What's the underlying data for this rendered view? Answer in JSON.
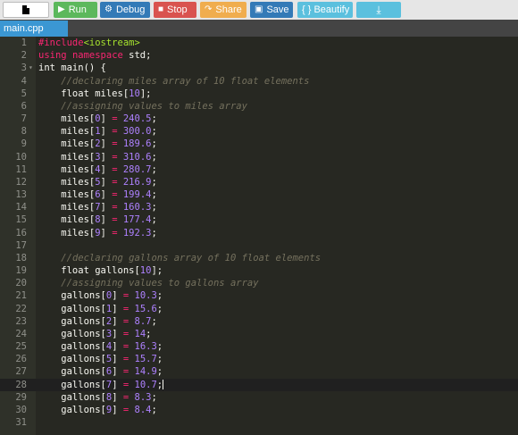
{
  "toolbar": {
    "new_label": "",
    "run_label": "Run",
    "debug_label": "Debug",
    "stop_label": "Stop",
    "share_label": "Share",
    "save_label": "Save",
    "beautify_label": "{ } Beautify",
    "download_label": ""
  },
  "tabs": [
    {
      "label": "main.cpp"
    }
  ],
  "editor": {
    "active_line": 28,
    "lines": [
      {
        "n": "1",
        "fold": "",
        "text": "#include<iostream>"
      },
      {
        "n": "2",
        "fold": "",
        "text": "using namespace std;"
      },
      {
        "n": "3",
        "fold": "▾",
        "text": "int main() {"
      },
      {
        "n": "4",
        "fold": "",
        "text": "    //declaring miles array of 10 float elements"
      },
      {
        "n": "5",
        "fold": "",
        "text": "    float miles[10];"
      },
      {
        "n": "6",
        "fold": "",
        "text": "    //assigning values to miles array"
      },
      {
        "n": "7",
        "fold": "",
        "text": "    miles[0] = 240.5;"
      },
      {
        "n": "8",
        "fold": "",
        "text": "    miles[1] = 300.0;"
      },
      {
        "n": "9",
        "fold": "",
        "text": "    miles[2] = 189.6;"
      },
      {
        "n": "10",
        "fold": "",
        "text": "    miles[3] = 310.6;"
      },
      {
        "n": "11",
        "fold": "",
        "text": "    miles[4] = 280.7;"
      },
      {
        "n": "12",
        "fold": "",
        "text": "    miles[5] = 216.9;"
      },
      {
        "n": "13",
        "fold": "",
        "text": "    miles[6] = 199.4;"
      },
      {
        "n": "14",
        "fold": "",
        "text": "    miles[7] = 160.3;"
      },
      {
        "n": "15",
        "fold": "",
        "text": "    miles[8] = 177.4;"
      },
      {
        "n": "16",
        "fold": "",
        "text": "    miles[9] = 192.3;"
      },
      {
        "n": "17",
        "fold": "",
        "text": ""
      },
      {
        "n": "18",
        "fold": "",
        "text": "    //declaring gallons array of 10 float elements"
      },
      {
        "n": "19",
        "fold": "",
        "text": "    float gallons[10];"
      },
      {
        "n": "20",
        "fold": "",
        "text": "    //assigning values to gallons array"
      },
      {
        "n": "21",
        "fold": "",
        "text": "    gallons[0] = 10.3;"
      },
      {
        "n": "22",
        "fold": "",
        "text": "    gallons[1] = 15.6;"
      },
      {
        "n": "23",
        "fold": "",
        "text": "    gallons[2] = 8.7;"
      },
      {
        "n": "24",
        "fold": "",
        "text": "    gallons[3] = 14;"
      },
      {
        "n": "25",
        "fold": "",
        "text": "    gallons[4] = 16.3;"
      },
      {
        "n": "26",
        "fold": "",
        "text": "    gallons[5] = 15.7;"
      },
      {
        "n": "27",
        "fold": "",
        "text": "    gallons[6] = 14.9;"
      },
      {
        "n": "28",
        "fold": "",
        "text": "    gallons[7] = 10.7;"
      },
      {
        "n": "29",
        "fold": "",
        "text": "    gallons[8] = 8.3;"
      },
      {
        "n": "30",
        "fold": "",
        "text": "    gallons[9] = 8.4;"
      },
      {
        "n": "31",
        "fold": "",
        "text": ""
      }
    ]
  },
  "colors": {
    "editor_bg": "#272822",
    "gutter_bg": "#2f3129",
    "tab_active": "#3b97d3",
    "run": "#5cb85c",
    "debug": "#337ab7",
    "stop": "#d9534f",
    "share": "#f0ad4e",
    "beautify": "#5bc0de"
  },
  "icons": {
    "new": "file-icon",
    "run": "play-icon",
    "debug": "debug-icon",
    "stop": "stop-icon",
    "share": "share-icon",
    "save": "floppy-icon",
    "download": "download-icon"
  }
}
